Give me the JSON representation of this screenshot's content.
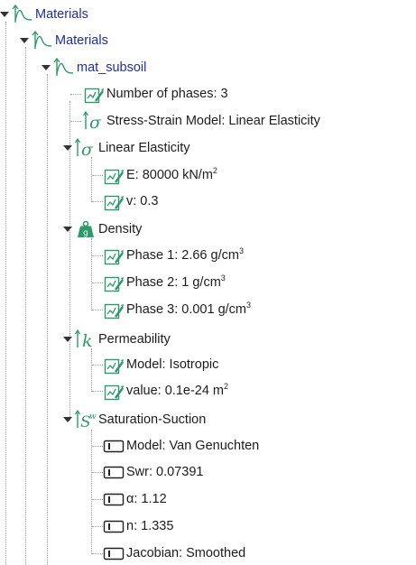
{
  "tree": {
    "root": {
      "label": "Materials",
      "icon": "curve-icon"
    },
    "materials": {
      "label": "Materials",
      "icon": "curve-icon"
    },
    "mat_subsoil": {
      "label": "mat_subsoil",
      "icon": "curve-icon"
    },
    "number_of_phases": {
      "label": "Number of phases: 3",
      "icon": "parameter-icon"
    },
    "stress_strain_model": {
      "label": "Stress-Strain Model: Linear Elasticity",
      "icon": "sigma-icon"
    },
    "linear_elasticity": {
      "label": "Linear Elasticity",
      "icon": "sigma-icon",
      "E": {
        "label": "E: 80000 kN/m",
        "sup": "2"
      },
      "v": {
        "label": "v: 0.3"
      }
    },
    "density": {
      "label": "Density",
      "icon": "weight-icon",
      "weight_letter": "g",
      "phase1": {
        "label": "Phase 1: 2.66 g/cm",
        "sup": "3"
      },
      "phase2": {
        "label": "Phase 2: 1 g/cm",
        "sup": "3"
      },
      "phase3": {
        "label": "Phase 3: 0.001 g/cm",
        "sup": "3"
      }
    },
    "permeability": {
      "label": "Permeability",
      "icon": "k-icon",
      "symbol": "k",
      "model": {
        "label": "Model: Isotropic"
      },
      "value": {
        "label": "value: 0.1e-24 m",
        "sup": "2"
      }
    },
    "saturation_suction": {
      "label": "Saturation-Suction",
      "icon": "sw-icon",
      "symbol_base": "S",
      "symbol_sup": "w",
      "model": {
        "label": "Model: Van Genuchten"
      },
      "swr": {
        "label": "Swr: 0.07391"
      },
      "alpha": {
        "label": "α: 1.12"
      },
      "n": {
        "label": "n: 1.335"
      },
      "jacobian": {
        "label": "Jacobian: Smoothed"
      }
    }
  },
  "colors": {
    "icon_green": "#2e9a6b",
    "blue_label": "#1f2e9e",
    "tree_line": "#9a9a9a"
  }
}
